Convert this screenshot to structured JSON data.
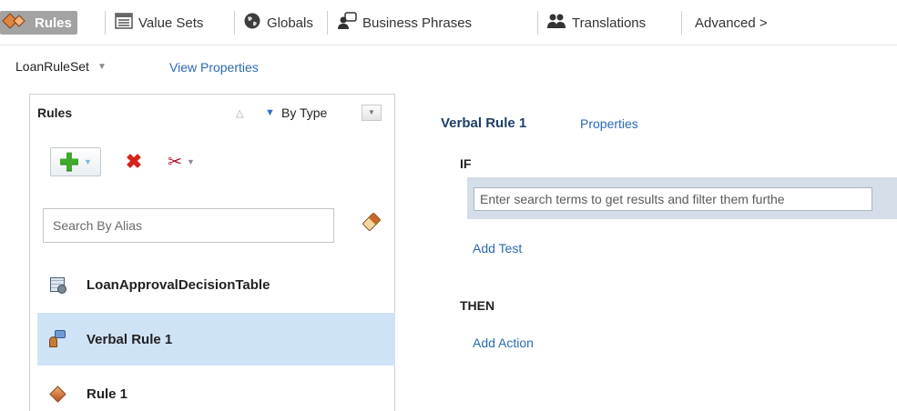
{
  "tabs": [
    {
      "label": "Rules",
      "icon": "rules-diamond-icon",
      "active": true
    },
    {
      "label": "Value Sets",
      "icon": "value-sets-icon"
    },
    {
      "label": "Globals",
      "icon": "globe-icon"
    },
    {
      "label": "Business Phrases",
      "icon": "business-phrases-icon"
    },
    {
      "label": "Translations",
      "icon": "translations-icon"
    },
    {
      "label": "Advanced >"
    }
  ],
  "ruleset": {
    "name": "LoanRuleSet",
    "view_properties": "View Properties"
  },
  "rules_panel": {
    "title": "Rules",
    "sort_label": "By Type",
    "search_placeholder": "Search By Alias",
    "items": [
      {
        "label": "LoanApprovalDecisionTable",
        "icon": "decision-table-icon",
        "selected": false
      },
      {
        "label": "Verbal Rule 1",
        "icon": "verbal-rule-icon",
        "selected": true
      },
      {
        "label": "Rule 1",
        "icon": "rule-diamond-icon",
        "selected": false
      }
    ]
  },
  "editor": {
    "title": "Verbal Rule 1",
    "properties": "Properties",
    "if_label": "IF",
    "condition_placeholder": "Enter search terms to get results and filter them furthe",
    "add_test": "Add Test",
    "then_label": "THEN",
    "add_action": "Add Action"
  },
  "colors": {
    "accent_link": "#2a6ab3",
    "selected_row": "#cfe3f7",
    "active_tab": "#a3a3a3"
  }
}
